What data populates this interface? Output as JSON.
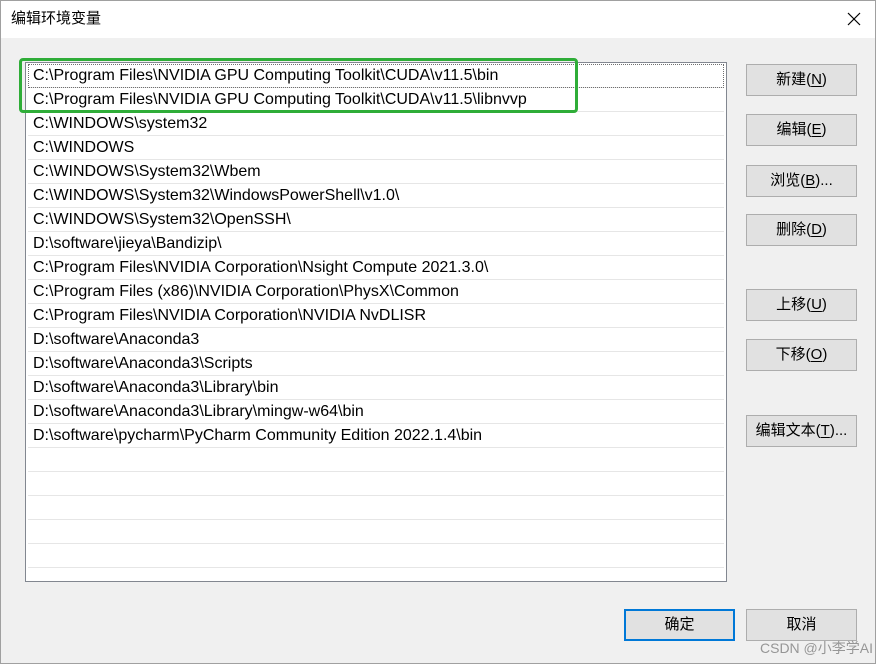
{
  "window": {
    "title": "编辑环境变量",
    "close_icon": "close-icon"
  },
  "path_list": {
    "focused_index": 0,
    "items": [
      "C:\\Program Files\\NVIDIA GPU Computing Toolkit\\CUDA\\v11.5\\bin",
      "C:\\Program Files\\NVIDIA GPU Computing Toolkit\\CUDA\\v11.5\\libnvvp",
      "C:\\WINDOWS\\system32",
      "C:\\WINDOWS",
      "C:\\WINDOWS\\System32\\Wbem",
      "C:\\WINDOWS\\System32\\WindowsPowerShell\\v1.0\\",
      "C:\\WINDOWS\\System32\\OpenSSH\\",
      "D:\\software\\jieya\\Bandizip\\",
      "C:\\Program Files\\NVIDIA Corporation\\Nsight Compute 2021.3.0\\",
      "C:\\Program Files (x86)\\NVIDIA Corporation\\PhysX\\Common",
      "C:\\Program Files\\NVIDIA Corporation\\NVIDIA NvDLISR",
      "D:\\software\\Anaconda3",
      "D:\\software\\Anaconda3\\Scripts",
      "D:\\software\\Anaconda3\\Library\\bin",
      "D:\\software\\Anaconda3\\Library\\mingw-w64\\bin",
      "D:\\software\\pycharm\\PyCharm Community Edition 2022.1.4\\bin"
    ]
  },
  "buttons": {
    "new": {
      "label": "新建(N)",
      "mnemonic": "N"
    },
    "edit": {
      "label": "编辑(E)",
      "mnemonic": "E"
    },
    "browse": {
      "label": "浏览(B)...",
      "mnemonic": "B"
    },
    "delete": {
      "label": "删除(D)",
      "mnemonic": "D"
    },
    "move_up": {
      "label": "上移(U)",
      "mnemonic": "U"
    },
    "move_down": {
      "label": "下移(O)",
      "mnemonic": "O"
    },
    "edit_text": {
      "label": "编辑文本(T)...",
      "mnemonic": "T"
    },
    "ok": {
      "label": "确定"
    },
    "cancel": {
      "label": "取消"
    }
  },
  "watermark": {
    "text": "CSDN @小李学AI"
  },
  "colors": {
    "default_button_border": "#0078d7",
    "annotation_highlight": "#2fad38"
  }
}
